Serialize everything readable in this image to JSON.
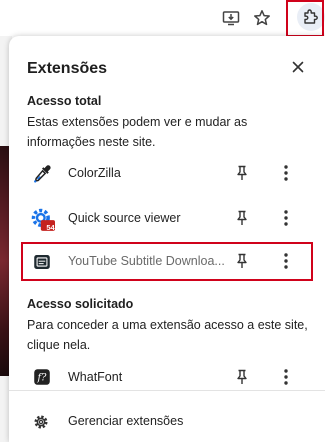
{
  "panel": {
    "title": "Extensões",
    "sections": {
      "full_access": {
        "heading": "Acesso total",
        "description": "Estas extensões podem ver e mudar as informações neste site."
      },
      "requested_access": {
        "heading": "Acesso solicitado",
        "description": "Para conceder a uma extensão acesso a este site, clique nela."
      }
    },
    "extensions": [
      {
        "name": "ColorZilla",
        "icon": "eyedropper-icon"
      },
      {
        "name": "Quick source viewer",
        "icon": "gear-badge-icon",
        "badge": "54"
      },
      {
        "name": "YouTube Subtitle Downloa...",
        "icon": "subtitle-icon"
      },
      {
        "name": "WhatFont",
        "icon": "font-icon"
      }
    ],
    "manage_label": "Gerenciar extensões"
  },
  "colors": {
    "highlight": "#d0021b",
    "badge": "#c5221f",
    "quick_source_gear": "#1a73e8"
  }
}
